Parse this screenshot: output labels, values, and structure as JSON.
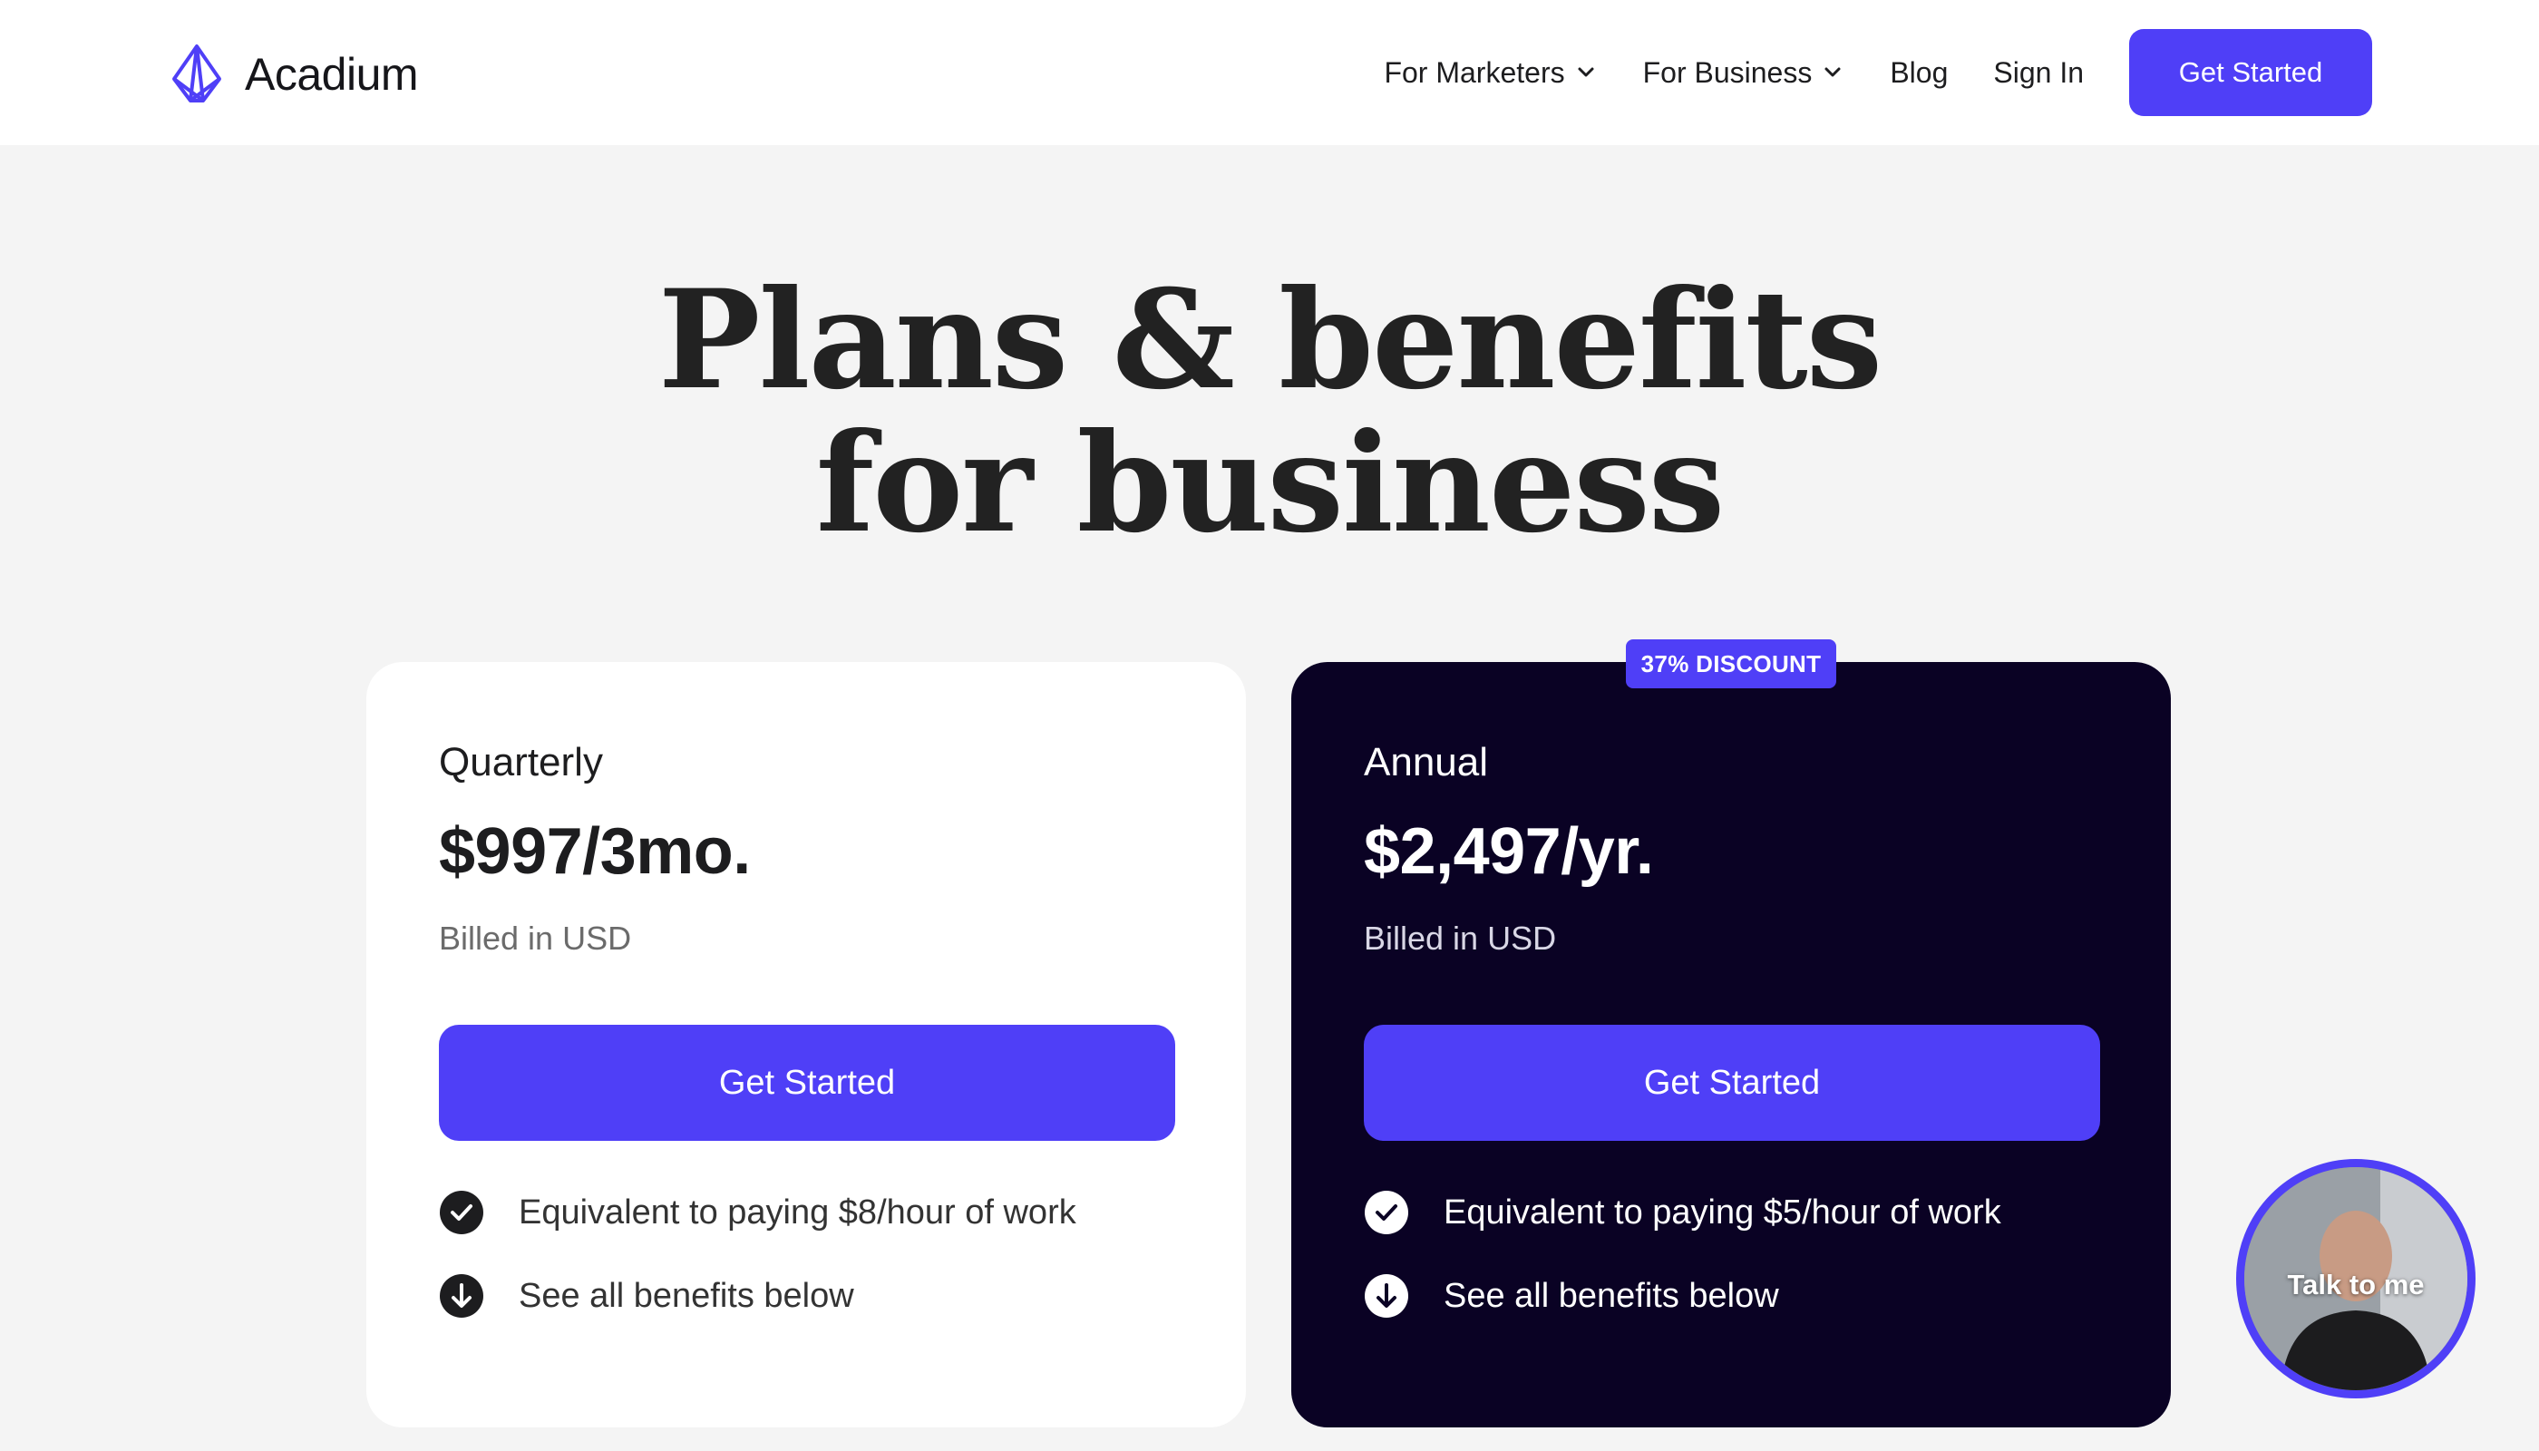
{
  "header": {
    "brand": "Acadium",
    "nav": [
      {
        "label": "For Marketers",
        "has_dropdown": true,
        "icon": "chevron-down-icon"
      },
      {
        "label": "For Business",
        "has_dropdown": true,
        "icon": "chevron-down-icon"
      },
      {
        "label": "Blog"
      },
      {
        "label": "Sign In"
      }
    ],
    "cta_label": "Get Started"
  },
  "hero": {
    "line1": "Plans & benefits",
    "line2": "for business"
  },
  "plans": [
    {
      "name": "Quarterly",
      "price": "$997/3mo.",
      "billed": "Billed in USD",
      "cta_label": "Get Started",
      "features": [
        {
          "text": "Equivalent to paying $8/hour of work",
          "icon": "check-circle-icon"
        },
        {
          "text": "See all benefits below",
          "icon": "arrow-down-circle-icon"
        }
      ]
    },
    {
      "name": "Annual",
      "badge": "37% DISCOUNT",
      "price": "$2,497/yr.",
      "billed": "Billed in USD",
      "cta_label": "Get Started",
      "features": [
        {
          "text": "Equivalent to paying $5/hour of work",
          "icon": "check-circle-icon"
        },
        {
          "text": "See all benefits below",
          "icon": "arrow-down-circle-icon"
        }
      ]
    }
  ],
  "video_widget": {
    "label": "Talk to me"
  },
  "colors": {
    "accent": "#4f3ff7",
    "dark_card": "#0a0224",
    "page_bg": "#f4f4f4"
  }
}
